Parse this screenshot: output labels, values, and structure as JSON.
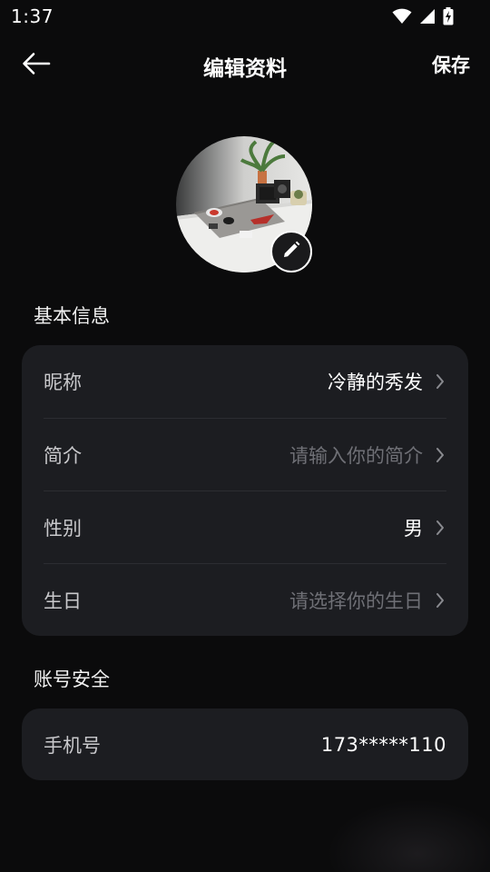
{
  "status_bar": {
    "time": "1:37",
    "icons": [
      "wifi-icon",
      "signal-icon",
      "battery-charging-icon"
    ]
  },
  "header": {
    "back_icon": "arrow-left-icon",
    "title": "编辑资料",
    "save_label": "保存"
  },
  "avatar": {
    "edit_icon": "pencil-icon"
  },
  "basic_info": {
    "title": "基本信息",
    "rows": [
      {
        "label": "昵称",
        "value": "冷静的秀发",
        "placeholder": false
      },
      {
        "label": "简介",
        "value": "请输入你的简介",
        "placeholder": true
      },
      {
        "label": "性别",
        "value": "男",
        "placeholder": false
      },
      {
        "label": "生日",
        "value": "请选择你的生日",
        "placeholder": true
      }
    ]
  },
  "account_security": {
    "title": "账号安全",
    "phone_label": "手机号",
    "phone_value": "173*****110"
  },
  "colors": {
    "background": "#0b0b0c",
    "card": "#1c1d21",
    "label": "#c9c9cc",
    "placeholder": "#6f7076",
    "text": "#ffffff"
  }
}
